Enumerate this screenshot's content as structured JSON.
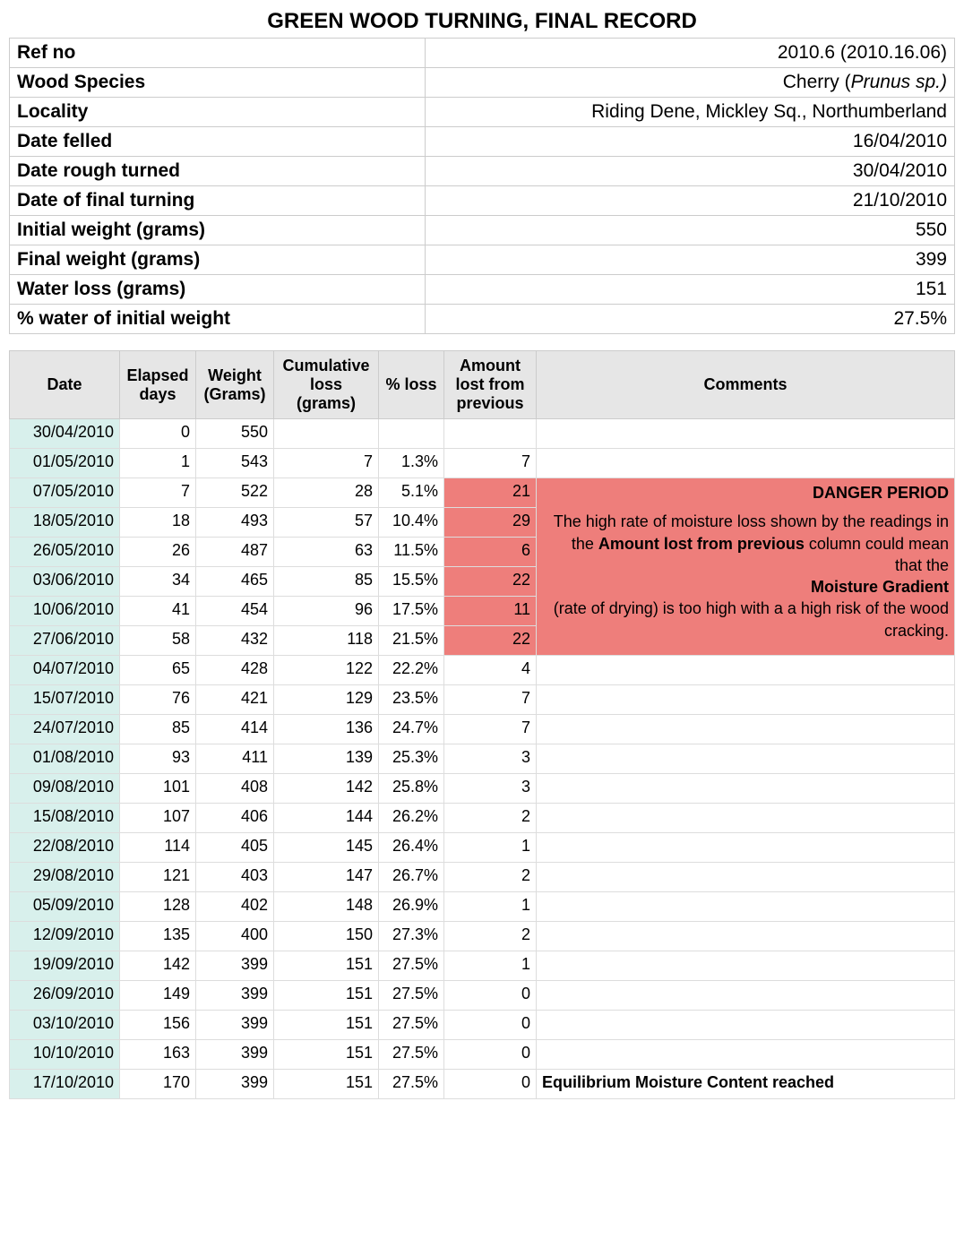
{
  "title": "GREEN WOOD TURNING, FINAL RECORD",
  "info": {
    "rows": [
      {
        "label": "Ref no",
        "value": "2010.6 (2010.16.06)"
      },
      {
        "label": "Wood Species",
        "value": "Cherry (",
        "italic_suffix": "Prunus sp.)"
      },
      {
        "label": "Locality",
        "value": "Riding Dene, Mickley Sq., Northumberland"
      },
      {
        "label": "Date felled",
        "value": "16/04/2010"
      },
      {
        "label": "Date rough turned",
        "value": "30/04/2010"
      },
      {
        "label": "Date of final turning",
        "value": "21/10/2010"
      },
      {
        "label": "Initial weight (grams)",
        "value": "550"
      },
      {
        "label": "Final weight (grams)",
        "value": "399"
      },
      {
        "label": "Water loss (grams)",
        "value": "151"
      },
      {
        "label": "% water of initial weight",
        "value": "27.5%"
      }
    ]
  },
  "columns": {
    "date": "Date",
    "elapsed": "Elapsed days",
    "weight": "Weight (Grams)",
    "cum": "Cumulative loss (grams)",
    "loss": "% loss",
    "amount": "Amount lost from previous",
    "comments": "Comments"
  },
  "danger": {
    "title": "DANGER PERIOD",
    "line1": "The high rate of moisture loss shown by the readings in the",
    "bold1": "Amount lost from previous",
    "line2": "column could mean that the",
    "bold2": "Moisture Gradient",
    "line3": "(rate of drying) is too high with a a high risk of the wood cracking."
  },
  "emc_text": "Equilibrium Moisture Content reached",
  "rows": [
    {
      "date": "30/04/2010",
      "elapsed": "0",
      "weight": "550",
      "cum": "",
      "loss": "",
      "amount": "",
      "danger": false
    },
    {
      "date": "01/05/2010",
      "elapsed": "1",
      "weight": "543",
      "cum": "7",
      "loss": "1.3%",
      "amount": "7",
      "danger": false
    },
    {
      "date": "07/05/2010",
      "elapsed": "7",
      "weight": "522",
      "cum": "28",
      "loss": "5.1%",
      "amount": "21",
      "danger": true,
      "danger_start": true
    },
    {
      "date": "18/05/2010",
      "elapsed": "18",
      "weight": "493",
      "cum": "57",
      "loss": "10.4%",
      "amount": "29",
      "danger": true
    },
    {
      "date": "26/05/2010",
      "elapsed": "26",
      "weight": "487",
      "cum": "63",
      "loss": "11.5%",
      "amount": "6",
      "danger": true
    },
    {
      "date": "03/06/2010",
      "elapsed": "34",
      "weight": "465",
      "cum": "85",
      "loss": "15.5%",
      "amount": "22",
      "danger": true
    },
    {
      "date": "10/06/2010",
      "elapsed": "41",
      "weight": "454",
      "cum": "96",
      "loss": "17.5%",
      "amount": "11",
      "danger": true
    },
    {
      "date": "27/06/2010",
      "elapsed": "58",
      "weight": "432",
      "cum": "118",
      "loss": "21.5%",
      "amount": "22",
      "danger": true
    },
    {
      "date": "04/07/2010",
      "elapsed": "65",
      "weight": "428",
      "cum": "122",
      "loss": "22.2%",
      "amount": "4",
      "danger": false
    },
    {
      "date": "15/07/2010",
      "elapsed": "76",
      "weight": "421",
      "cum": "129",
      "loss": "23.5%",
      "amount": "7",
      "danger": false
    },
    {
      "date": "24/07/2010",
      "elapsed": "85",
      "weight": "414",
      "cum": "136",
      "loss": "24.7%",
      "amount": "7",
      "danger": false
    },
    {
      "date": "01/08/2010",
      "elapsed": "93",
      "weight": "411",
      "cum": "139",
      "loss": "25.3%",
      "amount": "3",
      "danger": false
    },
    {
      "date": "09/08/2010",
      "elapsed": "101",
      "weight": "408",
      "cum": "142",
      "loss": "25.8%",
      "amount": "3",
      "danger": false
    },
    {
      "date": "15/08/2010",
      "elapsed": "107",
      "weight": "406",
      "cum": "144",
      "loss": "26.2%",
      "amount": "2",
      "danger": false
    },
    {
      "date": "22/08/2010",
      "elapsed": "114",
      "weight": "405",
      "cum": "145",
      "loss": "26.4%",
      "amount": "1",
      "danger": false
    },
    {
      "date": "29/08/2010",
      "elapsed": "121",
      "weight": "403",
      "cum": "147",
      "loss": "26.7%",
      "amount": "2",
      "danger": false
    },
    {
      "date": "05/09/2010",
      "elapsed": "128",
      "weight": "402",
      "cum": "148",
      "loss": "26.9%",
      "amount": "1",
      "danger": false
    },
    {
      "date": "12/09/2010",
      "elapsed": "135",
      "weight": "400",
      "cum": "150",
      "loss": "27.3%",
      "amount": "2",
      "danger": false
    },
    {
      "date": "19/09/2010",
      "elapsed": "142",
      "weight": "399",
      "cum": "151",
      "loss": "27.5%",
      "amount": "1",
      "danger": false
    },
    {
      "date": "26/09/2010",
      "elapsed": "149",
      "weight": "399",
      "cum": "151",
      "loss": "27.5%",
      "amount": "0",
      "danger": false
    },
    {
      "date": "03/10/2010",
      "elapsed": "156",
      "weight": "399",
      "cum": "151",
      "loss": "27.5%",
      "amount": "0",
      "danger": false
    },
    {
      "date": "10/10/2010",
      "elapsed": "163",
      "weight": "399",
      "cum": "151",
      "loss": "27.5%",
      "amount": "0",
      "danger": false
    },
    {
      "date": "17/10/2010",
      "elapsed": "170",
      "weight": "399",
      "cum": "151",
      "loss": "27.5%",
      "amount": "0",
      "danger": false,
      "emc": true
    }
  ],
  "chart_data": {
    "type": "table",
    "title": "Green wood drying weight record",
    "columns": [
      "Date",
      "Elapsed days",
      "Weight (Grams)",
      "Cumulative loss (grams)",
      "% loss",
      "Amount lost from previous"
    ],
    "x": [
      0,
      1,
      7,
      18,
      26,
      34,
      41,
      58,
      65,
      76,
      85,
      93,
      101,
      107,
      114,
      121,
      128,
      135,
      142,
      149,
      156,
      163,
      170
    ],
    "series": [
      {
        "name": "Weight (Grams)",
        "values": [
          550,
          543,
          522,
          493,
          487,
          465,
          454,
          432,
          428,
          421,
          414,
          411,
          408,
          406,
          405,
          403,
          402,
          400,
          399,
          399,
          399,
          399,
          399
        ]
      },
      {
        "name": "Cumulative loss (grams)",
        "values": [
          null,
          7,
          28,
          57,
          63,
          85,
          96,
          118,
          122,
          129,
          136,
          139,
          142,
          144,
          145,
          147,
          148,
          150,
          151,
          151,
          151,
          151,
          151
        ]
      },
      {
        "name": "% loss",
        "values": [
          null,
          1.3,
          5.1,
          10.4,
          11.5,
          15.5,
          17.5,
          21.5,
          22.2,
          23.5,
          24.7,
          25.3,
          25.8,
          26.2,
          26.4,
          26.7,
          26.9,
          27.3,
          27.5,
          27.5,
          27.5,
          27.5,
          27.5
        ]
      },
      {
        "name": "Amount lost from previous",
        "values": [
          null,
          7,
          21,
          29,
          6,
          22,
          11,
          22,
          4,
          7,
          7,
          3,
          3,
          2,
          1,
          2,
          1,
          2,
          1,
          0,
          0,
          0,
          0
        ]
      }
    ]
  }
}
